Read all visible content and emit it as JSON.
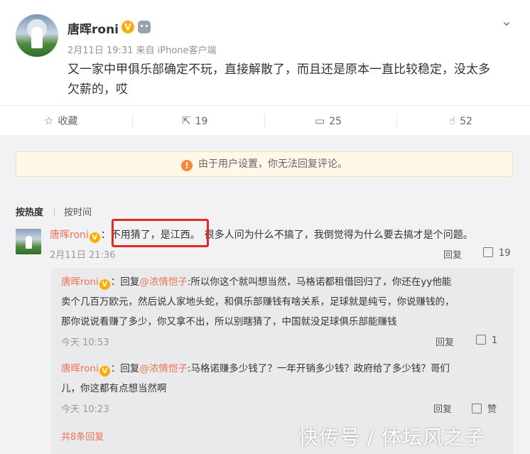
{
  "post": {
    "author": "唐晖roni",
    "badge": "V",
    "meta": "2月11日 19:31 来自 iPhone客户端",
    "text_line1": "又一家中甲俱乐部确定不玩，直接解散了，而且还是原本一直比较稳定，没太多",
    "text_line2": "欠薪的，哎"
  },
  "actions": {
    "favorite": "收藏",
    "repost": "19",
    "comment": "25",
    "like": "52"
  },
  "notice": "由于用户设置，你无法回复评论。",
  "sort": {
    "hot": "按热度",
    "time": "按时间"
  },
  "comment": {
    "user": "唐晖roni",
    "colon": "：",
    "highlight": "不用猜了，是江西。",
    "rest": "很多人问为什么不搞了，我倒觉得为什么要去搞才是个问题。",
    "time": "2月11日 21:36",
    "reply": "回复",
    "likes": "19"
  },
  "replies": [
    {
      "user": "唐晖roni",
      "prefix": "：回复",
      "mention": "@浓情恺子",
      "line1": ":所以你这个就叫想当然，马格诺都租借回归了，你还在yy他能",
      "line2": "卖个几百万欧元，然后说人家地头蛇，和俱乐部赚钱有啥关系，足球就是纯亏，你说赚钱的，",
      "line3": "那你说说看赚了多少，你又拿不出，所以别瞎猜了，中国就没足球俱乐部能赚钱",
      "time": "今天 10:53",
      "reply": "回复",
      "likes": "1"
    },
    {
      "user": "唐晖roni",
      "prefix": "：回复",
      "mention": "@浓情恺子",
      "line1": ":马格诺赚多少钱了？一年开销多少钱？政府给了多少钱？哥们",
      "line2": "儿，你这都有点想当然啊",
      "time": "今天 10:23",
      "reply": "回复",
      "likes": "赞"
    }
  ],
  "more": "共8条回复",
  "watermark": "快传号 / 体坛风之子",
  "colors": {
    "accent": "#eb7350",
    "highlight_border": "#e02b20",
    "badge": "#ffab00"
  }
}
